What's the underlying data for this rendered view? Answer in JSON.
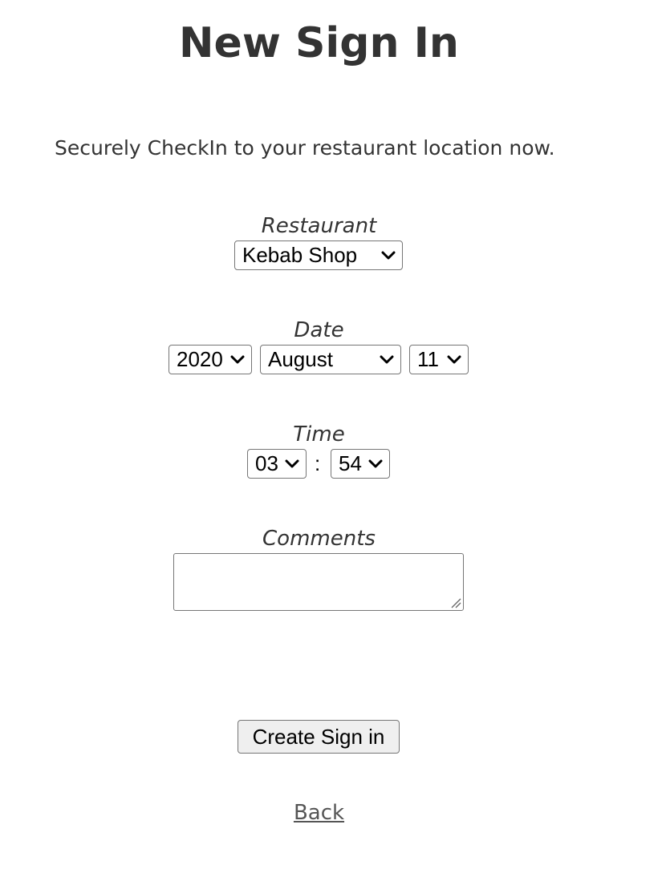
{
  "page": {
    "title": "New Sign In",
    "intro": "Securely CheckIn to your restaurant location now."
  },
  "form": {
    "restaurant": {
      "label": "Restaurant",
      "selected": "Kebab Shop"
    },
    "date": {
      "label": "Date",
      "year": "2020",
      "month": "August",
      "day": "11"
    },
    "time": {
      "label": "Time",
      "hour": "03",
      "separator": ":",
      "minute": "54"
    },
    "comments": {
      "label": "Comments",
      "value": ""
    },
    "submit_label": "Create Sign in",
    "back_label": "Back"
  },
  "icons": {
    "select_arrow": "chevron-down-icon",
    "textarea_grip": "resize-grip-icon"
  },
  "colors": {
    "text": "#333333",
    "control_border": "#767676",
    "button_bg": "#efefef",
    "link": "#555555"
  }
}
